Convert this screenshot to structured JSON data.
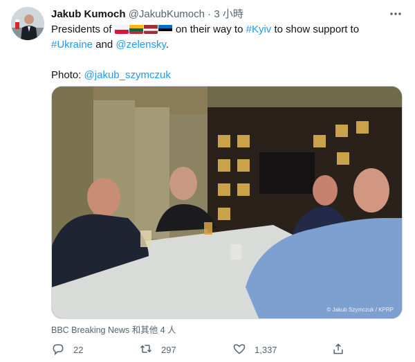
{
  "tweet": {
    "author_name": "Jakub Kumoch",
    "author_handle": "@JakubKumoch",
    "separator": "·",
    "time": "3 小時",
    "text_part1": "Presidents of ",
    "text_part2": " on their way to ",
    "hashtag_kyiv": "#Kyiv",
    "text_part3": " to show support to",
    "hashtag_ukraine": "#Ukraine",
    "text_part4": " and ",
    "mention_zelensky": "@zelensky",
    "text_part5": ".",
    "photo_label": "Photo: ",
    "photo_handle": "@jakub_szymczuk",
    "photo_credit": "© Jakub Szymczuk / KPRP",
    "liked_by": "BBC Breaking News 和其他 4 人"
  },
  "flags": [
    "poland-flag",
    "lithuania-flag",
    "latvia-flag",
    "estonia-flag"
  ],
  "actions": {
    "reply_count": "22",
    "retweet_count": "297",
    "like_count": "1,337"
  },
  "colors": {
    "link": "#1d9bf0",
    "secondary": "#536471",
    "primary": "#0f1419"
  }
}
